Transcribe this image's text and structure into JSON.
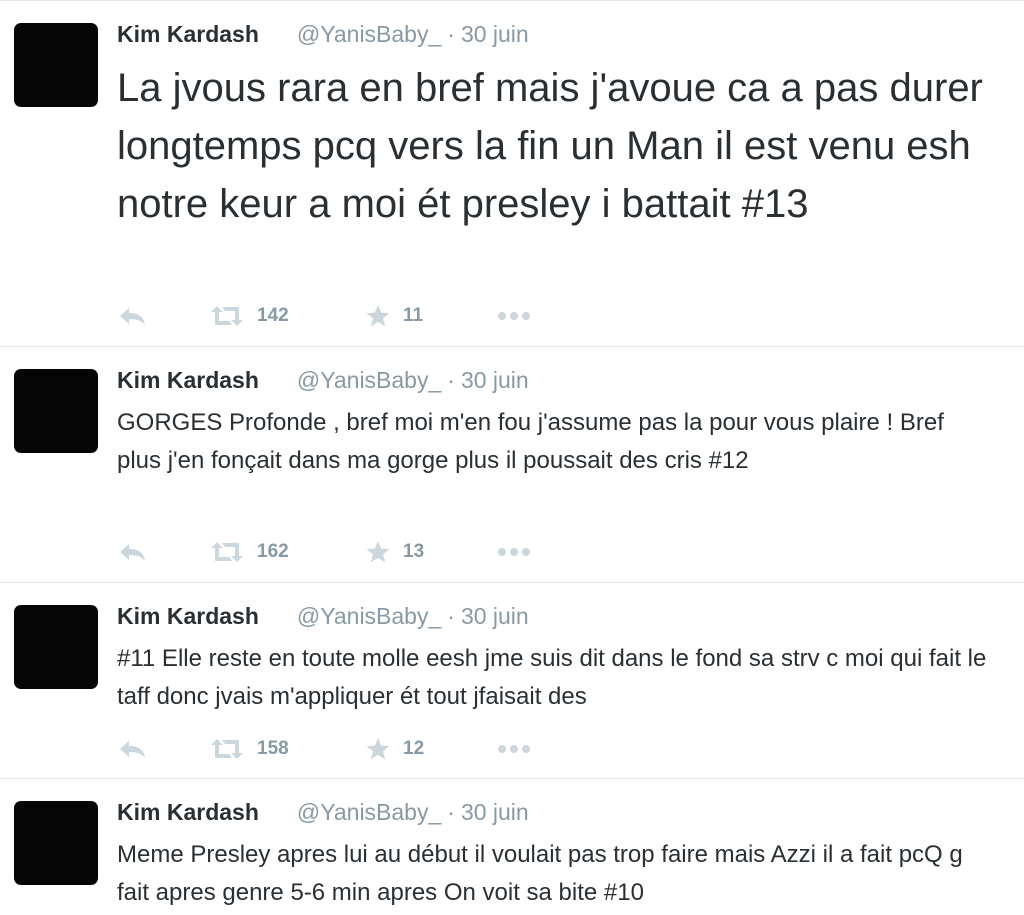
{
  "tweets": [
    {
      "name": "Kim Kardash",
      "handle": "@YanisBaby_",
      "separator": "·",
      "time": "30 juin",
      "text": "La jvous rara en bref mais j'avoue ca a pas durer longtemps pcq vers la fin un Man il est venu esh notre keur a moi ét presley i battait #13",
      "retweets": "142",
      "favorites": "11"
    },
    {
      "name": "Kim Kardash",
      "handle": "@YanisBaby_",
      "separator": "·",
      "time": "30 juin",
      "text": "GORGES Profonde , bref moi m'en fou j'assume pas la pour vous plaire ! Bref plus j'en fonçait dans ma gorge plus il poussait des cris #12",
      "retweets": "162",
      "favorites": "13"
    },
    {
      "name": "Kim Kardash",
      "handle": "@YanisBaby_",
      "separator": "·",
      "time": "30 juin",
      "text": "#11 Elle reste en toute molle eesh jme suis dit dans le fond sa strv c moi qui fait le taff donc jvais m'appliquer ét tout jfaisait des",
      "retweets": "158",
      "favorites": "12"
    },
    {
      "name": "Kim Kardash",
      "handle": "@YanisBaby_",
      "separator": "·",
      "time": "30 juin",
      "text": "Meme Presley apres lui au début il voulait pas trop faire mais Azzi il a fait pcQ g fait  apres genre 5-6 min apres On voit sa bite #10"
    }
  ],
  "icons": {
    "reply": "reply-icon",
    "retweet": "retweet-icon",
    "favorite": "star-icon",
    "more": "more-icon"
  },
  "colors": {
    "text": "#292f33",
    "muted": "#8899a6",
    "icon": "#ccd6dd",
    "divider": "#e1e8ed"
  }
}
